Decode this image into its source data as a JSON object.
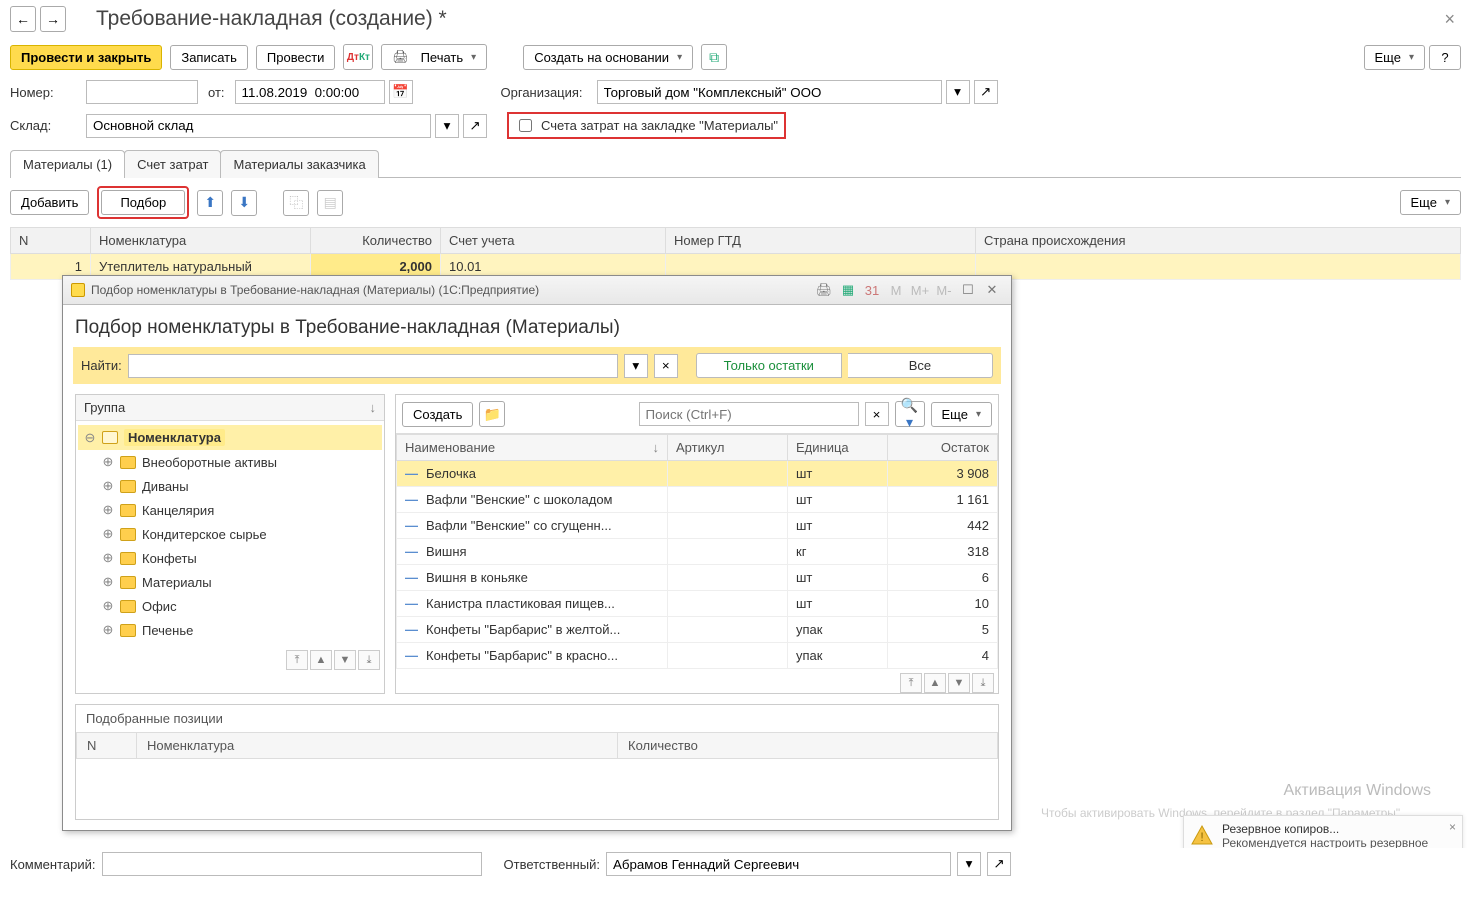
{
  "header": {
    "title": "Требование-накладная (создание) *"
  },
  "toolbar": {
    "post_close": "Провести и закрыть",
    "write": "Записать",
    "post": "Провести",
    "print": "Печать",
    "create_based": "Создать на основании",
    "more": "Еще",
    "help": "?"
  },
  "form": {
    "number_lbl": "Номер:",
    "from_lbl": "от:",
    "date": "11.08.2019  0:00:00",
    "org_lbl": "Организация:",
    "org_val": "Торговый дом \"Комплексный\" ООО",
    "wh_lbl": "Склад:",
    "wh_val": "Основной склад",
    "cost_cb": "Счета затрат на закладке \"Материалы\""
  },
  "tabs": {
    "t1": "Материалы (1)",
    "t2": "Счет затрат",
    "t3": "Материалы заказчика"
  },
  "subtoolbar": {
    "add": "Добавить",
    "pick": "Подбор",
    "more": "Еще"
  },
  "grid": {
    "cols": {
      "n": "N",
      "nom": "Номенклатура",
      "qty": "Количество",
      "acc": "Счет учета",
      "gtd": "Номер ГТД",
      "country": "Страна происхождения"
    },
    "row": {
      "n": "1",
      "nom": "Утеплитель натуральный",
      "qty": "2,000",
      "acc": "10.01"
    }
  },
  "dialog": {
    "wintitle": "Подбор номенклатуры в Требование-накладная (Материалы)  (1С:Предприятие)",
    "h1": "Подбор номенклатуры в Требование-накладная (Материалы)",
    "find_lbl": "Найти:",
    "only_stock": "Только остатки",
    "all": "Все",
    "group_lbl": "Группа",
    "tree": {
      "root": "Номенклатура",
      "items": [
        "Внеоборотные активы",
        "Диваны",
        "Канцелярия",
        "Кондитерское сырье",
        "Конфеты",
        "Материалы",
        "Офис",
        "Печенье"
      ]
    },
    "tool": {
      "create": "Создать",
      "search_ph": "Поиск (Ctrl+F)",
      "more": "Еще"
    },
    "cols": {
      "name": "Наименование",
      "art": "Артикул",
      "unit": "Единица",
      "stock": "Остаток"
    },
    "rows": [
      {
        "name": "Белочка",
        "unit": "шт",
        "stock": "3 908"
      },
      {
        "name": "Вафли \"Венские\" с шоколадом",
        "unit": "шт",
        "stock": "1 161"
      },
      {
        "name": "Вафли \"Венские\" со сгущенн...",
        "unit": "шт",
        "stock": "442"
      },
      {
        "name": "Вишня",
        "unit": "кг",
        "stock": "318"
      },
      {
        "name": "Вишня в коньяке",
        "unit": "шт",
        "stock": "6"
      },
      {
        "name": "Канистра пластиковая пищев...",
        "unit": "шт",
        "stock": "10"
      },
      {
        "name": "Конфеты \"Барбарис\" в желтой...",
        "unit": "упак",
        "stock": "5"
      },
      {
        "name": "Конфеты \"Барбарис\" в красно...",
        "unit": "упак",
        "stock": "4"
      }
    ],
    "picked_lbl": "Подобранные позиции",
    "picked_cols": {
      "n": "N",
      "nom": "Номенклатура",
      "qty": "Количество"
    }
  },
  "bottom": {
    "comment_lbl": "Комментарий:",
    "resp_lbl": "Ответственный:",
    "resp_val": "Абрамов Геннадий Сергеевич"
  },
  "watermark": {
    "l1": "Активация Windows",
    "l2": "Чтобы активировать Windows, перейдите в раздел \"Параметры\"."
  },
  "toast": {
    "t1": "Резервное копиров...",
    "t2": "Рекомендуется настроить резервное к..."
  }
}
